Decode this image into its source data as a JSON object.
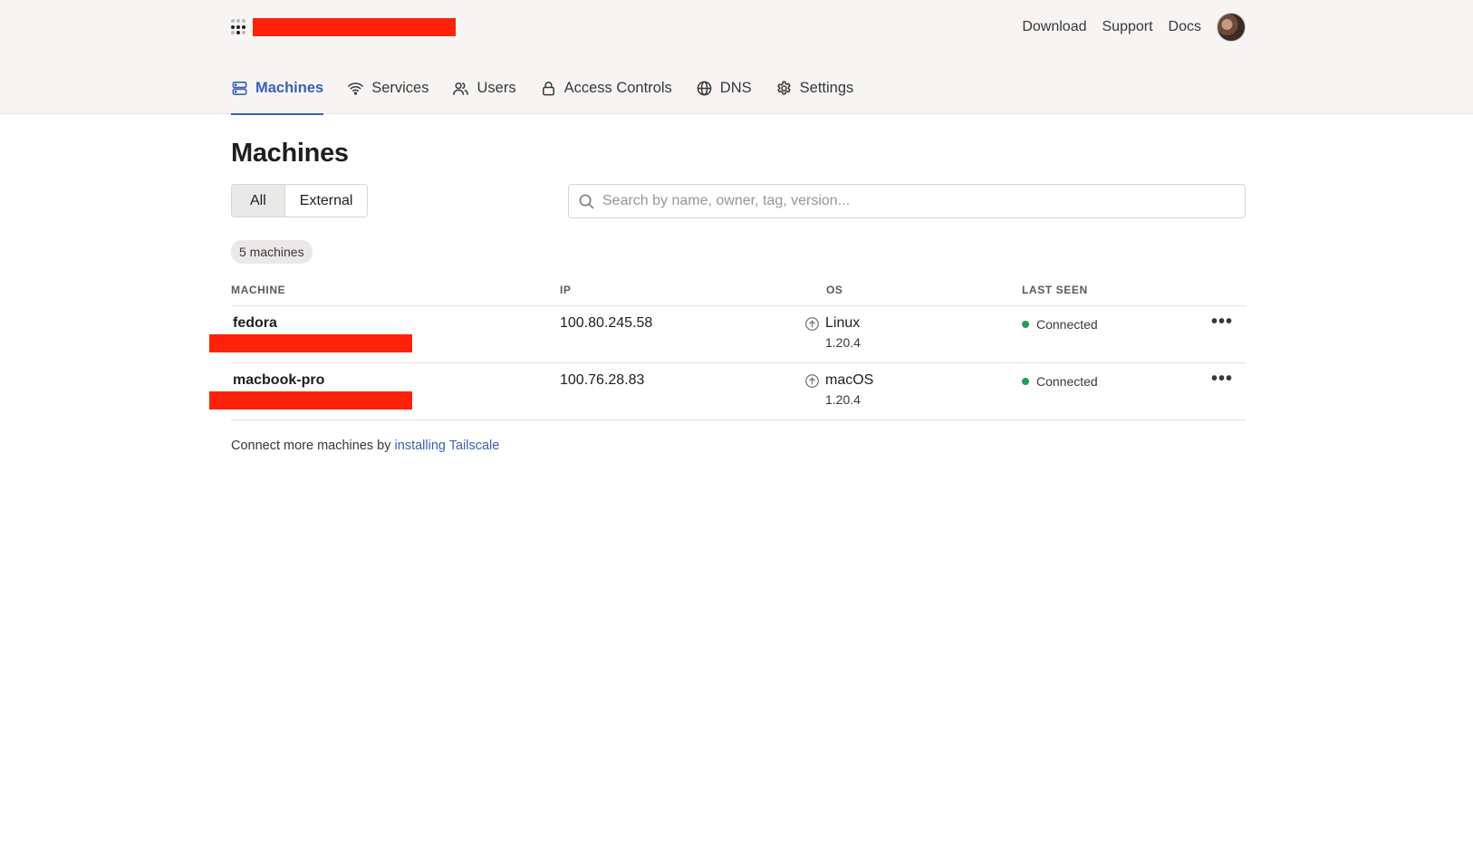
{
  "header": {
    "links": [
      "Download",
      "Support",
      "Docs"
    ]
  },
  "tabs": [
    {
      "label": "Machines",
      "icon": "machines-icon"
    },
    {
      "label": "Services",
      "icon": "wifi-icon"
    },
    {
      "label": "Users",
      "icon": "users-icon"
    },
    {
      "label": "Access Controls",
      "icon": "lock-icon"
    },
    {
      "label": "DNS",
      "icon": "globe-icon"
    },
    {
      "label": "Settings",
      "icon": "gear-icon"
    }
  ],
  "page": {
    "title": "Machines",
    "filter_all": "All",
    "filter_external": "External",
    "search_placeholder": "Search by name, owner, tag, version...",
    "count": "5 machines"
  },
  "table": {
    "columns": [
      "MACHINE",
      "IP",
      "OS",
      "LAST SEEN"
    ],
    "rows": [
      {
        "name": "fedora",
        "ip": "100.80.245.58",
        "os": "Linux",
        "version": "1.20.4",
        "status": "Connected"
      },
      {
        "name": "macbook-pro",
        "ip": "100.76.28.83",
        "os": "macOS",
        "version": "1.20.4",
        "status": "Connected"
      }
    ],
    "more_glyph": "•••"
  },
  "footer": {
    "text": "Connect more machines by",
    "link": "installing Tailscale"
  },
  "colors": {
    "accent": "#3b5fb8",
    "redaction": "#ff220a",
    "connected": "#1f9d5a"
  }
}
